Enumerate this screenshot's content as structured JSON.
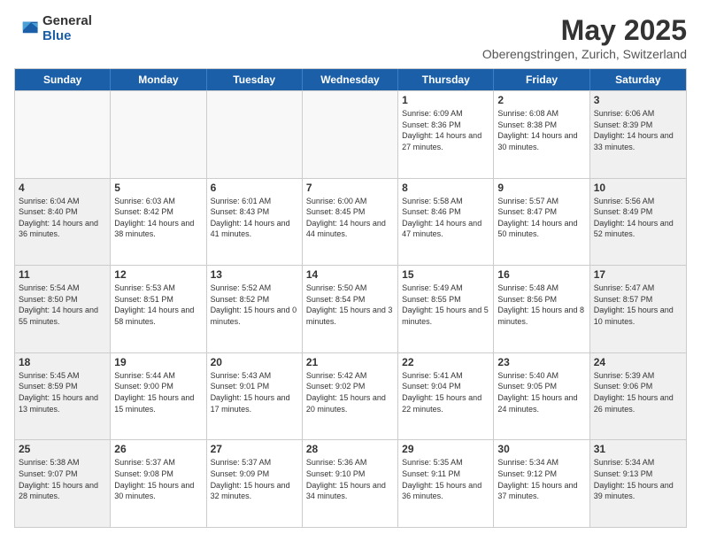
{
  "logo": {
    "general": "General",
    "blue": "Blue"
  },
  "header": {
    "title": "May 2025",
    "subtitle": "Oberengstringen, Zurich, Switzerland"
  },
  "weekdays": [
    "Sunday",
    "Monday",
    "Tuesday",
    "Wednesday",
    "Thursday",
    "Friday",
    "Saturday"
  ],
  "rows": [
    [
      {
        "day": "",
        "info": ""
      },
      {
        "day": "",
        "info": ""
      },
      {
        "day": "",
        "info": ""
      },
      {
        "day": "",
        "info": ""
      },
      {
        "day": "1",
        "info": "Sunrise: 6:09 AM\nSunset: 8:36 PM\nDaylight: 14 hours\nand 27 minutes."
      },
      {
        "day": "2",
        "info": "Sunrise: 6:08 AM\nSunset: 8:38 PM\nDaylight: 14 hours\nand 30 minutes."
      },
      {
        "day": "3",
        "info": "Sunrise: 6:06 AM\nSunset: 8:39 PM\nDaylight: 14 hours\nand 33 minutes."
      }
    ],
    [
      {
        "day": "4",
        "info": "Sunrise: 6:04 AM\nSunset: 8:40 PM\nDaylight: 14 hours\nand 36 minutes."
      },
      {
        "day": "5",
        "info": "Sunrise: 6:03 AM\nSunset: 8:42 PM\nDaylight: 14 hours\nand 38 minutes."
      },
      {
        "day": "6",
        "info": "Sunrise: 6:01 AM\nSunset: 8:43 PM\nDaylight: 14 hours\nand 41 minutes."
      },
      {
        "day": "7",
        "info": "Sunrise: 6:00 AM\nSunset: 8:45 PM\nDaylight: 14 hours\nand 44 minutes."
      },
      {
        "day": "8",
        "info": "Sunrise: 5:58 AM\nSunset: 8:46 PM\nDaylight: 14 hours\nand 47 minutes."
      },
      {
        "day": "9",
        "info": "Sunrise: 5:57 AM\nSunset: 8:47 PM\nDaylight: 14 hours\nand 50 minutes."
      },
      {
        "day": "10",
        "info": "Sunrise: 5:56 AM\nSunset: 8:49 PM\nDaylight: 14 hours\nand 52 minutes."
      }
    ],
    [
      {
        "day": "11",
        "info": "Sunrise: 5:54 AM\nSunset: 8:50 PM\nDaylight: 14 hours\nand 55 minutes."
      },
      {
        "day": "12",
        "info": "Sunrise: 5:53 AM\nSunset: 8:51 PM\nDaylight: 14 hours\nand 58 minutes."
      },
      {
        "day": "13",
        "info": "Sunrise: 5:52 AM\nSunset: 8:52 PM\nDaylight: 15 hours\nand 0 minutes."
      },
      {
        "day": "14",
        "info": "Sunrise: 5:50 AM\nSunset: 8:54 PM\nDaylight: 15 hours\nand 3 minutes."
      },
      {
        "day": "15",
        "info": "Sunrise: 5:49 AM\nSunset: 8:55 PM\nDaylight: 15 hours\nand 5 minutes."
      },
      {
        "day": "16",
        "info": "Sunrise: 5:48 AM\nSunset: 8:56 PM\nDaylight: 15 hours\nand 8 minutes."
      },
      {
        "day": "17",
        "info": "Sunrise: 5:47 AM\nSunset: 8:57 PM\nDaylight: 15 hours\nand 10 minutes."
      }
    ],
    [
      {
        "day": "18",
        "info": "Sunrise: 5:45 AM\nSunset: 8:59 PM\nDaylight: 15 hours\nand 13 minutes."
      },
      {
        "day": "19",
        "info": "Sunrise: 5:44 AM\nSunset: 9:00 PM\nDaylight: 15 hours\nand 15 minutes."
      },
      {
        "day": "20",
        "info": "Sunrise: 5:43 AM\nSunset: 9:01 PM\nDaylight: 15 hours\nand 17 minutes."
      },
      {
        "day": "21",
        "info": "Sunrise: 5:42 AM\nSunset: 9:02 PM\nDaylight: 15 hours\nand 20 minutes."
      },
      {
        "day": "22",
        "info": "Sunrise: 5:41 AM\nSunset: 9:04 PM\nDaylight: 15 hours\nand 22 minutes."
      },
      {
        "day": "23",
        "info": "Sunrise: 5:40 AM\nSunset: 9:05 PM\nDaylight: 15 hours\nand 24 minutes."
      },
      {
        "day": "24",
        "info": "Sunrise: 5:39 AM\nSunset: 9:06 PM\nDaylight: 15 hours\nand 26 minutes."
      }
    ],
    [
      {
        "day": "25",
        "info": "Sunrise: 5:38 AM\nSunset: 9:07 PM\nDaylight: 15 hours\nand 28 minutes."
      },
      {
        "day": "26",
        "info": "Sunrise: 5:37 AM\nSunset: 9:08 PM\nDaylight: 15 hours\nand 30 minutes."
      },
      {
        "day": "27",
        "info": "Sunrise: 5:37 AM\nSunset: 9:09 PM\nDaylight: 15 hours\nand 32 minutes."
      },
      {
        "day": "28",
        "info": "Sunrise: 5:36 AM\nSunset: 9:10 PM\nDaylight: 15 hours\nand 34 minutes."
      },
      {
        "day": "29",
        "info": "Sunrise: 5:35 AM\nSunset: 9:11 PM\nDaylight: 15 hours\nand 36 minutes."
      },
      {
        "day": "30",
        "info": "Sunrise: 5:34 AM\nSunset: 9:12 PM\nDaylight: 15 hours\nand 37 minutes."
      },
      {
        "day": "31",
        "info": "Sunrise: 5:34 AM\nSunset: 9:13 PM\nDaylight: 15 hours\nand 39 minutes."
      }
    ]
  ]
}
